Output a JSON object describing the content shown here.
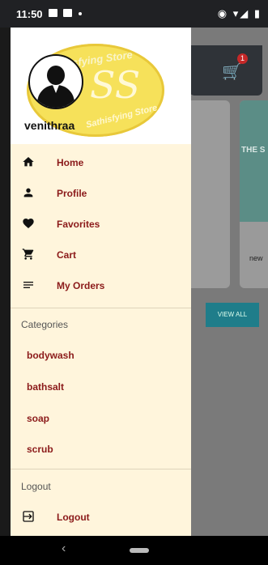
{
  "status_bar": {
    "time": "11:50"
  },
  "background": {
    "cart_badge": "1",
    "card_image_text": "THE S",
    "card_caption": "new",
    "view_all_label": "VIEW ALL"
  },
  "drawer": {
    "logo_text_top": "thisfying Store",
    "logo_monogram": "SS",
    "logo_text_bottom": "Sathisfying Store",
    "username": "venithraa",
    "menu": [
      {
        "icon": "home-icon",
        "label": "Home"
      },
      {
        "icon": "person-icon",
        "label": "Profile"
      },
      {
        "icon": "heart-icon",
        "label": "Favorites"
      },
      {
        "icon": "cart-icon",
        "label": "Cart"
      },
      {
        "icon": "list-icon",
        "label": "My Orders"
      }
    ],
    "categories_title": "Categories",
    "categories": [
      "bodywash",
      "bathsalt",
      "soap",
      "scrub"
    ],
    "logout_section_title": "Logout",
    "logout_label": "Logout"
  },
  "colors": {
    "drawer_bg": "#fff5dc",
    "label_accent": "#8b1a1a",
    "logo_yellow": "#f6e15a"
  }
}
